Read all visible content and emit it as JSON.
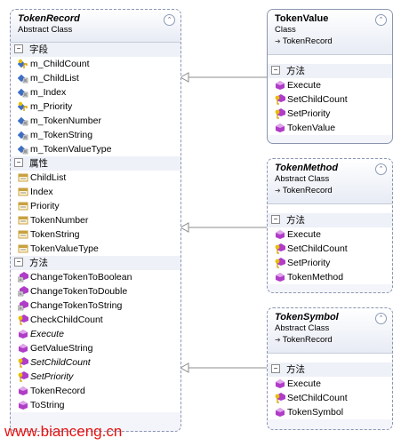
{
  "token_record": {
    "title": "TokenRecord",
    "stereotype": "Abstract Class",
    "fields_header": "字段",
    "fields": [
      {
        "name": "m_ChildCount",
        "icon": "protected-field-icon"
      },
      {
        "name": "m_ChildList",
        "icon": "private-field-icon"
      },
      {
        "name": "m_Index",
        "icon": "private-field-icon"
      },
      {
        "name": "m_Priority",
        "icon": "protected-field-icon"
      },
      {
        "name": "m_TokenNumber",
        "icon": "private-field-icon"
      },
      {
        "name": "m_TokenString",
        "icon": "private-field-icon"
      },
      {
        "name": "m_TokenValueType",
        "icon": "private-field-icon"
      }
    ],
    "props_header": "属性",
    "properties": [
      "ChildList",
      "Index",
      "Priority",
      "TokenNumber",
      "TokenString",
      "TokenValueType"
    ],
    "methods_header": "方法",
    "methods": [
      {
        "name": "ChangeTokenToBoolean",
        "italic": false,
        "icon": "private-method-icon"
      },
      {
        "name": "ChangeTokenToDouble",
        "italic": false,
        "icon": "private-method-icon"
      },
      {
        "name": "ChangeTokenToString",
        "italic": false,
        "icon": "private-method-icon"
      },
      {
        "name": "CheckChildCount",
        "italic": false,
        "icon": "protected-method-icon"
      },
      {
        "name": "Execute",
        "italic": true,
        "icon": "public-method-icon"
      },
      {
        "name": "GetValueString",
        "italic": false,
        "icon": "public-method-icon"
      },
      {
        "name": "SetChildCount",
        "italic": true,
        "icon": "protected-method-icon"
      },
      {
        "name": "SetPriority",
        "italic": true,
        "icon": "protected-method-icon"
      },
      {
        "name": "TokenRecord",
        "italic": false,
        "icon": "public-method-icon"
      },
      {
        "name": "ToString",
        "italic": false,
        "icon": "public-method-icon"
      }
    ]
  },
  "token_value": {
    "title": "TokenValue",
    "stereotype": "Class",
    "parent": "TokenRecord",
    "methods_header": "方法",
    "methods": [
      {
        "name": "Execute",
        "icon": "public-method-icon"
      },
      {
        "name": "SetChildCount",
        "icon": "protected-method-icon"
      },
      {
        "name": "SetPriority",
        "icon": "protected-method-icon"
      },
      {
        "name": "TokenValue",
        "icon": "public-method-icon"
      }
    ]
  },
  "token_method": {
    "title": "TokenMethod",
    "stereotype": "Abstract Class",
    "parent": "TokenRecord",
    "methods_header": "方法",
    "methods": [
      {
        "name": "Execute",
        "icon": "public-method-icon"
      },
      {
        "name": "SetChildCount",
        "icon": "protected-method-icon"
      },
      {
        "name": "SetPriority",
        "icon": "protected-method-icon"
      },
      {
        "name": "TokenMethod",
        "icon": "public-method-icon"
      }
    ]
  },
  "token_symbol": {
    "title": "TokenSymbol",
    "stereotype": "Abstract Class",
    "parent": "TokenRecord",
    "methods_header": "方法",
    "methods": [
      {
        "name": "Execute",
        "icon": "public-method-icon"
      },
      {
        "name": "SetChildCount",
        "icon": "protected-method-icon"
      },
      {
        "name": "TokenSymbol",
        "icon": "public-method-icon"
      }
    ]
  },
  "colors": {
    "method": "#b03cc8",
    "field": "#3c6ec8",
    "property": "#c8a040",
    "watermark": "#e81010"
  },
  "watermark": "www.bianceng.cn"
}
